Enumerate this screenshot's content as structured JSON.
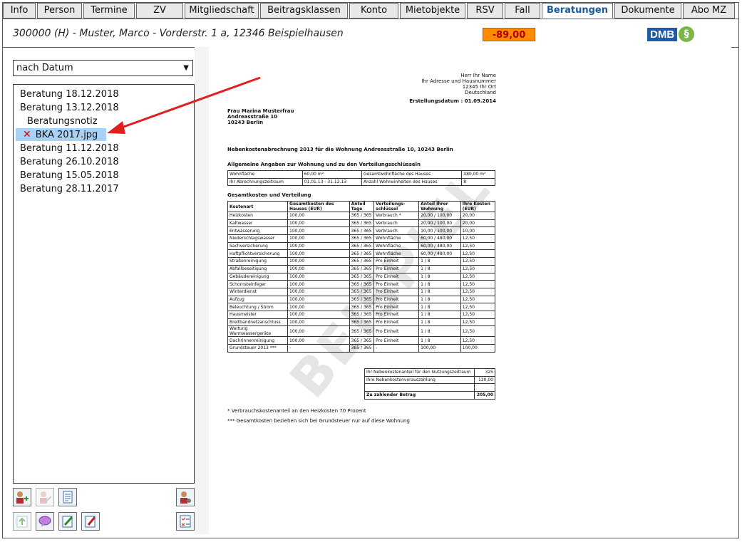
{
  "tabs": [
    "Info",
    "Person",
    "Termine",
    "ZV",
    "Mitgliedschaft",
    "Beitragsklassen",
    "Konto",
    "Mietobjekte",
    "RSV",
    "Fall",
    "Beratungen",
    "Dokumente",
    "Abo MZ"
  ],
  "active_tab": "Beratungen",
  "header": {
    "title": "300000 (H) - Muster, Marco - Vorderstr. 1 a, 12346 Beispielhausen",
    "balance": "-89,00",
    "logo_text": "DMB",
    "logo_mark": "§"
  },
  "left": {
    "sort_select": "nach Datum",
    "tree": [
      {
        "label": "Beratung 18.12.2018"
      },
      {
        "label": "Beratung 13.12.2018"
      },
      {
        "label": "Beratungsnotiz"
      },
      {
        "label": "BKA 2017.jpg"
      },
      {
        "label": "Beratung 11.12.2018"
      },
      {
        "label": "Beratung 26.10.2018"
      },
      {
        "label": "Beratung 15.05.2018"
      },
      {
        "label": "Beratung 28.11.2017"
      }
    ]
  },
  "document": {
    "sender": [
      "Herr Ihr Name",
      "Ihr Adresse und Hausnummer",
      "12345 Ihr Ort",
      "Deutschland"
    ],
    "date": "Erstellungsdatum : 01.09.2014",
    "recipient": [
      "Frau Marina Musterfrau",
      "Andreasstraße 10",
      "10243 Berlin"
    ],
    "subject": "Nebenkostenabrechnung 2013 für die Wohnung Andreasstraße 10, 10243 Berlin",
    "general_heading": "Allgemeine Angaben zur Wohnung und zu den Verteilungsschlüsseln",
    "general_rows": [
      [
        "Wohnfläche",
        "60,00 m²",
        "Gesamtwohnfläche des Hauses",
        "480,00 m²"
      ],
      [
        "Ihr Abrechnungszeitraum",
        "01.01.13 - 31.12.13",
        "Anzahl Wohneinheiten des Hauses",
        "8"
      ]
    ],
    "costs_heading": "Gesamtkosten und Verteilung",
    "cost_headers": [
      "Kostenart",
      "Gesamtkosten des Hauses (EUR)",
      "Anteil Tage",
      "Verteilungs-schlüssel",
      "Anteil Ihrer Wohnung",
      "Ihre Kosten (EUR)"
    ],
    "cost_rows": [
      [
        "Heizkosten",
        "100,00",
        "365 / 365",
        "Verbrauch *",
        "20,00 / 100,00",
        "20,00"
      ],
      [
        "Kaltwasser",
        "100,00",
        "365 / 365",
        "Verbrauch",
        "20,00 / 100,00",
        "20,00"
      ],
      [
        "Entwässerung",
        "100,00",
        "365 / 365",
        "Verbrauch",
        "10,00 / 100,00",
        "10,00"
      ],
      [
        "Niederschlagswasser",
        "100,00",
        "365 / 365",
        "Wohnfläche",
        "60,00 / 480,00",
        "12,50"
      ],
      [
        "Sachversicherung",
        "100,00",
        "365 / 365",
        "Wohnfläche",
        "60,00 / 480,00",
        "12,50"
      ],
      [
        "Haftpflichtversicherung",
        "100,00",
        "365 / 365",
        "Wohnfläche",
        "60,00 / 480,00",
        "12,50"
      ],
      [
        "Straßenreinigung",
        "100,00",
        "365 / 365",
        "Pro Einheit",
        "1 / 8",
        "12,50"
      ],
      [
        "Abfallbeseitigung",
        "100,00",
        "365 / 365",
        "Pro Einheit",
        "1 / 8",
        "12,50"
      ],
      [
        "Gebäudereinigung",
        "100,00",
        "365 / 365",
        "Pro Einheit",
        "1 / 8",
        "12,50"
      ],
      [
        "Schornsteinfeger",
        "100,00",
        "365 / 365",
        "Pro Einheit",
        "1 / 8",
        "12,50"
      ],
      [
        "Winterdienst",
        "100,00",
        "365 / 365",
        "Pro Einheit",
        "1 / 8",
        "12,50"
      ],
      [
        "Aufzug",
        "100,00",
        "365 / 365",
        "Pro Einheit",
        "1 / 8",
        "12,50"
      ],
      [
        "Beleuchtung / Strom",
        "100,00",
        "365 / 365",
        "Pro Einheit",
        "1 / 8",
        "12,50"
      ],
      [
        "Hausmeister",
        "100,00",
        "365 / 365",
        "Pro Einheit",
        "1 / 8",
        "12,50"
      ],
      [
        "Breitbandnetzanschluss",
        "100,00",
        "365 / 365",
        "Pro Einheit",
        "1 / 8",
        "12,50"
      ],
      [
        "Wartung Warmwassergeräte",
        "100,00",
        "365 / 365",
        "Pro Einheit",
        "1 / 8",
        "12,50"
      ],
      [
        "Dachrinnenreinigung",
        "100,00",
        "365 / 365",
        "Pro Einheit",
        "1 / 8",
        "12,50"
      ],
      [
        "Grundsteuer 2013 ***",
        "-",
        "365 / 365",
        "-",
        "100,00",
        "100,00"
      ]
    ],
    "summary_rows": [
      [
        "Ihr Nebenkostenanteil für den Nutzungszeitraum",
        "325"
      ],
      [
        "Ihre Nebenkostenvorauszahlung",
        "120,00"
      ],
      [
        "",
        ""
      ],
      [
        "Zu zahlender Betrag",
        "205,00"
      ]
    ],
    "footnote1": "* Verbrauchskostenanteil an den Heizkosten 70 Prozent",
    "footnote2": "*** Gesamtkosten beziehen sich bei Grundsteuer nur auf diese Wohnung",
    "watermark": "BEISPIEL"
  }
}
